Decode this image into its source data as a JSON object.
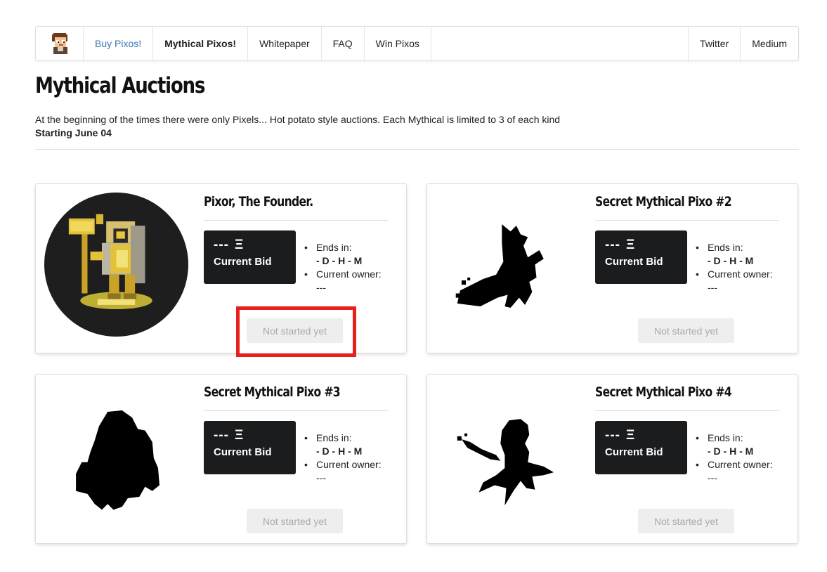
{
  "nav": {
    "logo_icon": "pixo-avatar-icon",
    "buy": "Buy Pixos!",
    "mythical": "Mythical Pixos!",
    "whitepaper": "Whitepaper",
    "faq": "FAQ",
    "win": "Win Pixos",
    "twitter": "Twitter",
    "medium": "Medium",
    "buy_color": "#3a78b5"
  },
  "page": {
    "title": "Mythical Auctions",
    "intro": "At the beginning of the times there were only Pixels... Hot potato style auctions. Each Mythical is limited to 3 of each kind",
    "start": "Starting June 04"
  },
  "cards": [
    {
      "name": "Pixor, The Founder.",
      "bid_amount": "---",
      "eth_symbol": "Ξ",
      "bid_label": "Current Bid",
      "ends_label": "Ends in:",
      "ends_value": "- D - H - M",
      "owner_label": "Current owner:",
      "owner_value": "---",
      "button": "Not started yet",
      "art_icon": "golden-knight-icon"
    },
    {
      "name": "Secret Mythical Pixo #2",
      "bid_amount": "---",
      "eth_symbol": "Ξ",
      "bid_label": "Current Bid",
      "ends_label": "Ends in:",
      "ends_value": "- D - H - M",
      "owner_label": "Current owner:",
      "owner_value": "---",
      "button": "Not started yet",
      "art_icon": "silhouette-fox-icon"
    },
    {
      "name": "Secret Mythical Pixo #3",
      "bid_amount": "---",
      "eth_symbol": "Ξ",
      "bid_label": "Current Bid",
      "ends_label": "Ends in:",
      "ends_value": "- D - H - M",
      "owner_label": "Current owner:",
      "owner_value": "---",
      "button": "Not started yet",
      "art_icon": "silhouette-blob-icon"
    },
    {
      "name": "Secret Mythical Pixo #4",
      "bid_amount": "---",
      "eth_symbol": "Ξ",
      "bid_label": "Current Bid",
      "ends_label": "Ends in:",
      "ends_value": "- D - H - M",
      "owner_label": "Current owner:",
      "owner_value": "---",
      "button": "Not started yet",
      "art_icon": "silhouette-plant-icon"
    }
  ],
  "annotation_color": "#e8201a"
}
